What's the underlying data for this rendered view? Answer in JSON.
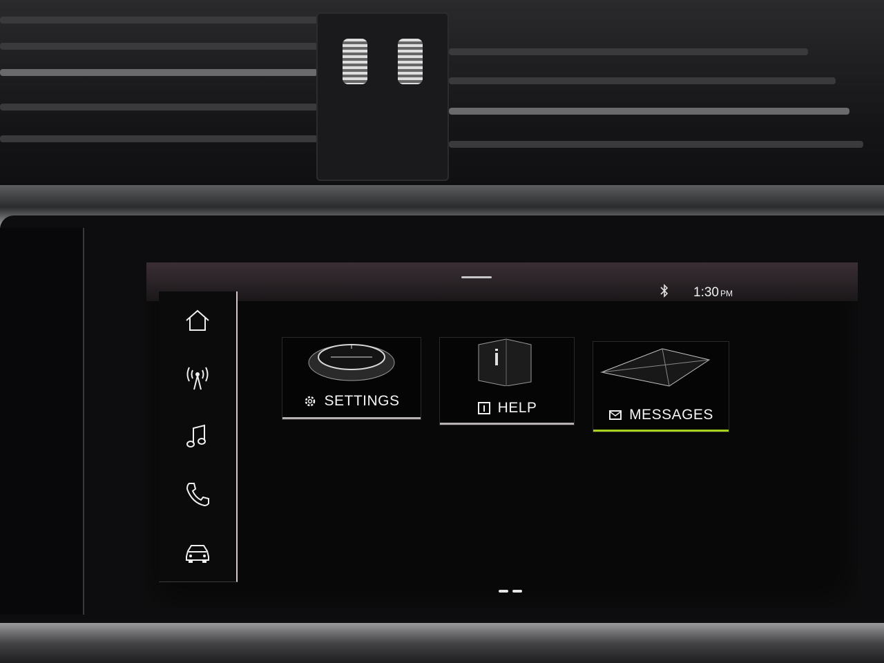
{
  "status_bar": {
    "bluetooth_icon": "bluetooth-icon",
    "time": "1:30",
    "ampm": "PM"
  },
  "sidebar": {
    "items": [
      {
        "name": "home",
        "icon": "home-icon"
      },
      {
        "name": "radio",
        "icon": "radio-antenna-icon"
      },
      {
        "name": "music",
        "icon": "music-note-icon"
      },
      {
        "name": "phone",
        "icon": "phone-icon"
      },
      {
        "name": "car",
        "icon": "car-icon"
      }
    ]
  },
  "tiles": [
    {
      "label": "SETTINGS",
      "icon": "gear-icon",
      "active": false
    },
    {
      "label": "HELP",
      "icon": "info-icon",
      "active": false
    },
    {
      "label": "MESSAGES",
      "icon": "envelope-icon",
      "active": true
    }
  ],
  "colors": {
    "active_accent": "#a8d21e",
    "text": "#f4f4f4"
  },
  "pagination": {
    "pages": 2
  }
}
